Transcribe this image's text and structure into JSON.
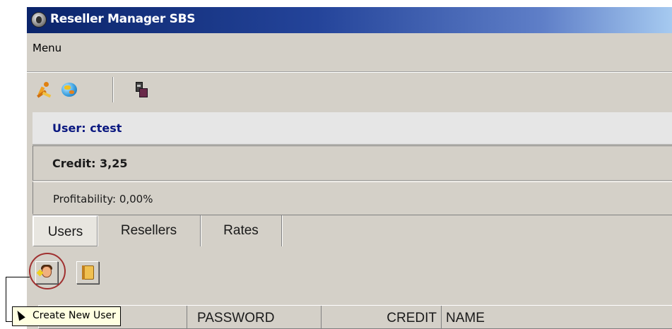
{
  "window": {
    "title": "Reseller Manager SBS"
  },
  "menubar": {
    "menu_label": "Menu"
  },
  "toolbar": {
    "icons": [
      "runner-icon",
      "globe-icon",
      "device-icon"
    ]
  },
  "info": {
    "user": "User: ctest",
    "credit": "Credit: 3,25",
    "profitability": "Profitability: 0,00%"
  },
  "tabs": [
    {
      "label": "Users",
      "selected": true
    },
    {
      "label": "Resellers",
      "selected": false
    },
    {
      "label": "Rates",
      "selected": false
    }
  ],
  "user_toolbar": {
    "icons": [
      "new-user-icon",
      "address-book-icon"
    ]
  },
  "grid": {
    "columns": [
      "",
      "PASSWORD",
      "CREDIT",
      "NAME"
    ]
  },
  "tooltip": {
    "text": "Create New User"
  },
  "colors": {
    "titlebar_start": "#0a246a",
    "titlebar_end": "#a6caf0",
    "window_bg": "#d4d0c8",
    "user_text": "#0a1880",
    "tooltip_bg": "#ffffe1",
    "highlight": "#a03030"
  }
}
